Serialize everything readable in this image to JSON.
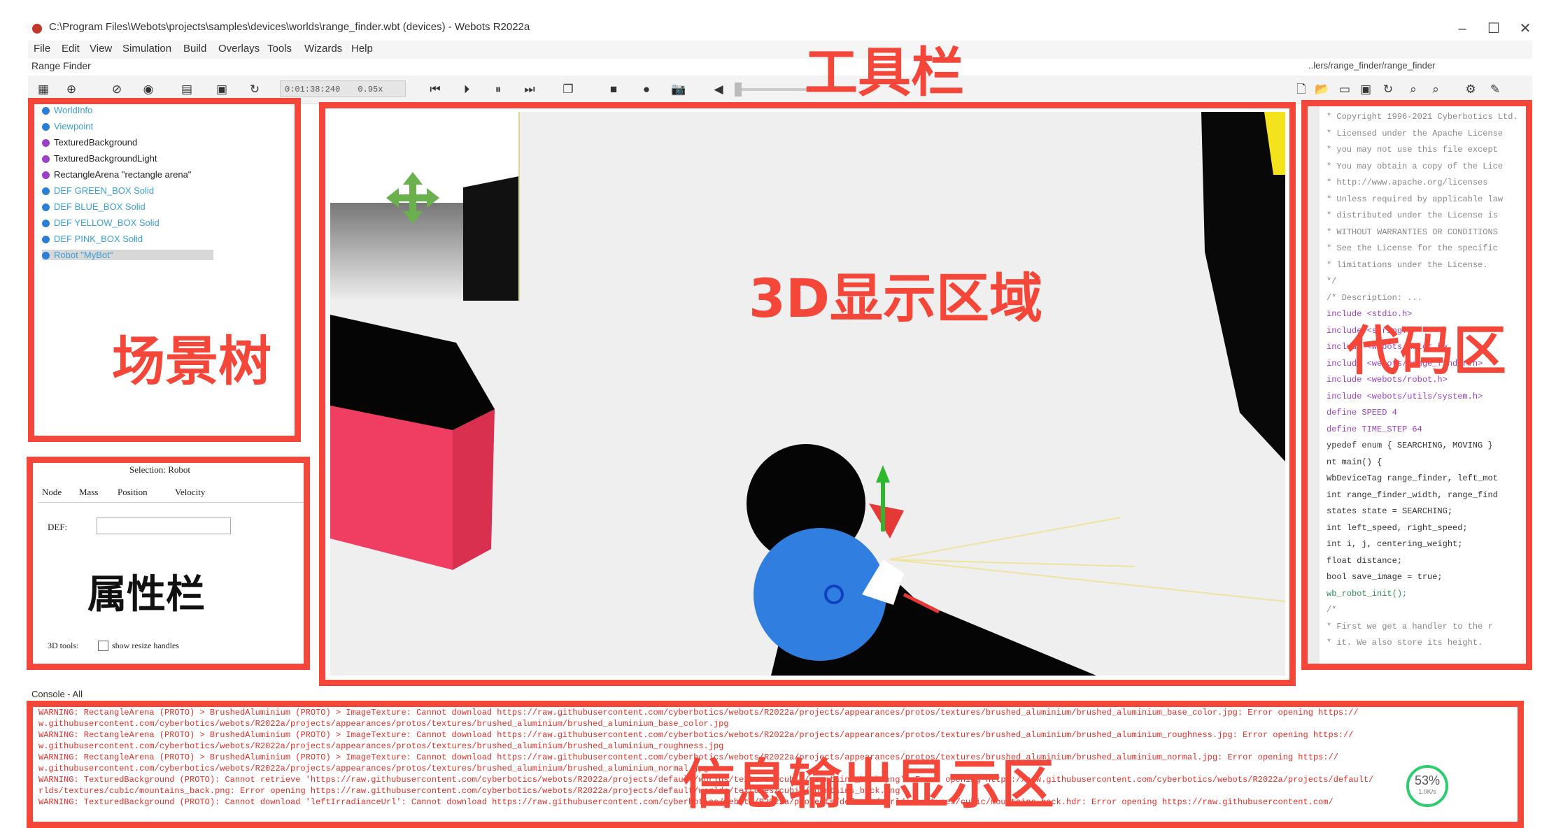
{
  "window": {
    "title": "C:\\Program Files\\Webots\\projects\\samples\\devices\\worlds\\range_finder.wbt (devices) - Webots R2022a",
    "minimize": "–",
    "maximize": "☐",
    "close": "✕"
  },
  "menu": [
    "File",
    "Edit",
    "View",
    "Simulation",
    "Build",
    "Overlays",
    "Tools",
    "Wizards",
    "Help"
  ],
  "scene_label": "Range Finder",
  "toolbar": {
    "time": "0:01:38:240",
    "speed": "0.95x"
  },
  "editor_path": "..lers/range_finder/range_finder",
  "scene_tree": [
    {
      "label": "WorldInfo",
      "color": "#2a7fd4",
      "text_color": "#3a9fd8"
    },
    {
      "label": "Viewpoint",
      "color": "#2a7fd4",
      "text_color": "#3a9fd8"
    },
    {
      "label": "TexturedBackground",
      "color": "#9b3fc8",
      "text_color": "#333333"
    },
    {
      "label": "TexturedBackgroundLight",
      "color": "#9b3fc8",
      "text_color": "#333333"
    },
    {
      "label": "RectangleArena \"rectangle arena\"",
      "color": "#9b3fc8",
      "text_color": "#333333"
    },
    {
      "label": "DEF GREEN_BOX Solid",
      "color": "#2a7fd4",
      "text_color": "#3a9fd8"
    },
    {
      "label": "DEF BLUE_BOX Solid",
      "color": "#2a7fd4",
      "text_color": "#3a9fd8"
    },
    {
      "label": "DEF YELLOW_BOX Solid",
      "color": "#2a7fd4",
      "text_color": "#3a9fd8"
    },
    {
      "label": "DEF PINK_BOX Solid",
      "color": "#2a7fd4",
      "text_color": "#3a9fd8"
    },
    {
      "label": "Robot \"MyBot\"",
      "color": "#2a7fd4",
      "text_color": "#3a9fd8",
      "selected": true
    }
  ],
  "field_editor": {
    "selection": "Selection: Robot",
    "tabs": [
      "Node",
      "Mass",
      "Position",
      "Velocity"
    ],
    "field_label": "DEF:",
    "tools_label": "3D tools:",
    "checkbox_label": "show resize handles"
  },
  "code_lines": [
    {
      "text": "* Copyright 1996-2021 Cyberbotics Ltd.",
      "color": "#888888"
    },
    {
      "text": "* Licensed under the Apache License",
      "color": "#888888"
    },
    {
      "text": "* you may not use this file except",
      "color": "#888888"
    },
    {
      "text": "* You may obtain a copy of the Lice",
      "color": "#888888"
    },
    {
      "text": "*     http://www.apache.org/licenses",
      "color": "#888888"
    },
    {
      "text": "* Unless required by applicable law",
      "color": "#888888"
    },
    {
      "text": "* distributed under the License is",
      "color": "#888888"
    },
    {
      "text": "* WITHOUT WARRANTIES OR CONDITIONS",
      "color": "#888888"
    },
    {
      "text": "* See the License for the specific",
      "color": "#888888"
    },
    {
      "text": "* limitations under the License.",
      "color": "#888888"
    },
    {
      "text": "*/",
      "color": "#888888"
    },
    {
      "text": "/* Description: ...",
      "color": "#888888"
    },
    {
      "text": "include <stdio.h>",
      "color": "#9b3fc8"
    },
    {
      "text": "include <string.h>",
      "color": "#9b3fc8"
    },
    {
      "text": "include <webots/motor.h>",
      "color": "#9b3fc8"
    },
    {
      "text": "include <webots/range_finder.h>",
      "color": "#9b3fc8"
    },
    {
      "text": "include <webots/robot.h>",
      "color": "#9b3fc8"
    },
    {
      "text": "include <webots/utils/system.h>",
      "color": "#9b3fc8"
    },
    {
      "text": "define SPEED 4",
      "color": "#9b3fc8"
    },
    {
      "text": "define TIME_STEP 64",
      "color": "#9b3fc8"
    },
    {
      "text": "ypedef enum { SEARCHING, MOVING }",
      "color": "#333333"
    },
    {
      "text": "nt main() {",
      "color": "#333333"
    },
    {
      "text": " WbDeviceTag range_finder, left_mot",
      "color": "#333333"
    },
    {
      "text": " int range_finder_width, range_find",
      "color": "#333333"
    },
    {
      "text": " states state = SEARCHING;",
      "color": "#333333"
    },
    {
      "text": " int left_speed, right_speed;",
      "color": "#333333"
    },
    {
      "text": " int i, j, centering_weight;",
      "color": "#333333"
    },
    {
      "text": " float distance;",
      "color": "#333333"
    },
    {
      "text": " bool save_image = true;",
      "color": "#333333"
    },
    {
      "text": " wb_robot_init();",
      "color": "#2e8b57"
    },
    {
      "text": " /*",
      "color": "#888888"
    },
    {
      "text": "  * First we get a handler to the r",
      "color": "#888888"
    },
    {
      "text": "  * it. We also store its height.",
      "color": "#888888"
    }
  ],
  "console_label": "Console - All",
  "console_lines": [
    "WARNING: RectangleArena (PROTO) > BrushedAluminium (PROTO) > ImageTexture: Cannot download https://raw.githubusercontent.com/cyberbotics/webots/R2022a/projects/appearances/protos/textures/brushed_aluminium/brushed_aluminium_base_color.jpg: Error opening https://",
    "w.githubusercontent.com/cyberbotics/webots/R2022a/projects/appearances/protos/textures/brushed_aluminium/brushed_aluminium_base_color.jpg",
    "WARNING: RectangleArena (PROTO) > BrushedAluminium (PROTO) > ImageTexture: Cannot download https://raw.githubusercontent.com/cyberbotics/webots/R2022a/projects/appearances/protos/textures/brushed_aluminium/brushed_aluminium_roughness.jpg: Error opening https://",
    "w.githubusercontent.com/cyberbotics/webots/R2022a/projects/appearances/protos/textures/brushed_aluminium/brushed_aluminium_roughness.jpg",
    "WARNING: RectangleArena (PROTO) > BrushedAluminium (PROTO) > ImageTexture: Cannot download https://raw.githubusercontent.com/cyberbotics/webots/R2022a/projects/appearances/protos/textures/brushed_aluminium/brushed_aluminium_normal.jpg: Error opening https://",
    "w.githubusercontent.com/cyberbotics/webots/R2022a/projects/appearances/protos/textures/brushed_aluminium/brushed_aluminium_normal.jpg",
    "WARNING: TexturedBackground (PROTO): Cannot retrieve 'https://raw.githubusercontent.com/cyberbotics/webots/R2022a/projects/default/worlds/textures/cubic/mountains_back.png': Error opening https://raw.githubusercontent.com/cyberbotics/webots/R2022a/projects/default/",
    "rlds/textures/cubic/mountains_back.png: Error opening https://raw.githubusercontent.com/cyberbotics/webots/R2022a/projects/default/worlds/textures/cubic/mountains_back.png",
    "WARNING: TexturedBackground (PROTO): Cannot download 'leftIrradianceUrl': Cannot download https://raw.githubusercontent.com/cyberbotics/webots/R2022a/projects/default/worlds/textures/cubic/mountains_back.hdr: Error opening https://raw.githubusercontent.com/"
  ],
  "progress_badge": {
    "percent": "53%",
    "sub": "1.0K/s"
  },
  "annotations": {
    "toolbar": "工具栏",
    "scene_tree": "场景树",
    "view3d": "3D显示区域",
    "code": "代码区",
    "fields": "属性栏",
    "console": "信息输出显示区"
  },
  "annotation_color": "#f4473a"
}
